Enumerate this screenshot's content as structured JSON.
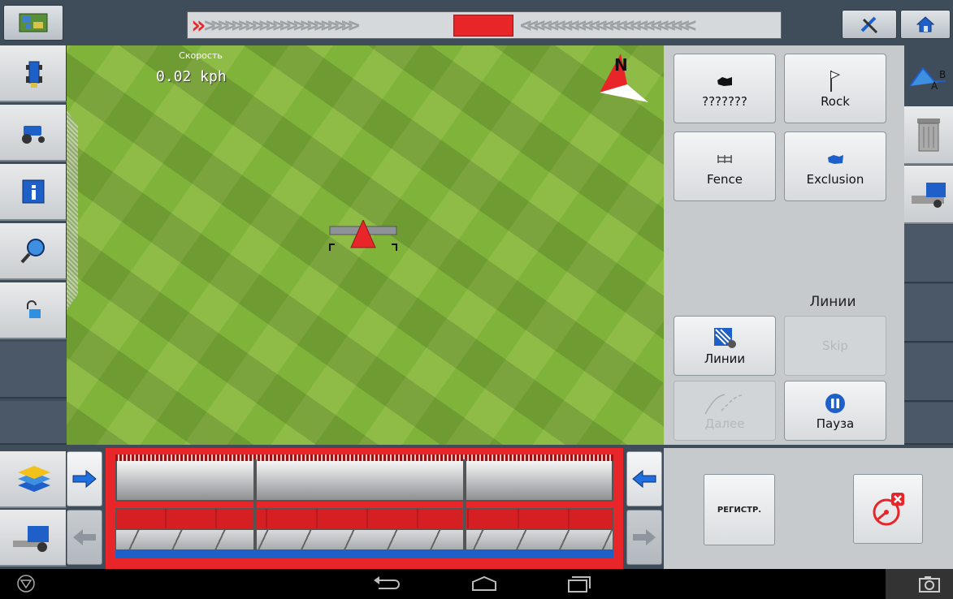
{
  "map": {
    "speed_label": "Скорость",
    "speed_value": "0.02 kph",
    "north_label": "N"
  },
  "markers": [
    {
      "label": "???????",
      "icon": "blob-icon"
    },
    {
      "label": "Rock",
      "icon": "flag-icon"
    },
    {
      "label": "Fence",
      "icon": "fence-icon"
    },
    {
      "label": "Exclusion",
      "icon": "exclusion-icon"
    }
  ],
  "lines": {
    "title": "Линии",
    "lines_button": "Линии",
    "skip_button": "Skip",
    "next_button": "Далее",
    "pause_button": "Пауза"
  },
  "bottom": {
    "register_button": "РЕГИСТР."
  },
  "colors": {
    "field_green": "#7fb33a",
    "toolbar_bg": "#3f4c5a",
    "panel_bg": "#c6cacd",
    "accent_red": "#e8262a",
    "accent_blue": "#1f5fc8"
  },
  "icons": {
    "top_left": "satellite-map-icon",
    "top_right_1": "tools-icon",
    "top_right_2": "home-icon",
    "nav_back": "back-icon",
    "nav_home": "home-outline-icon",
    "nav_recent": "recent-apps-icon",
    "screenshot": "camera-icon"
  }
}
